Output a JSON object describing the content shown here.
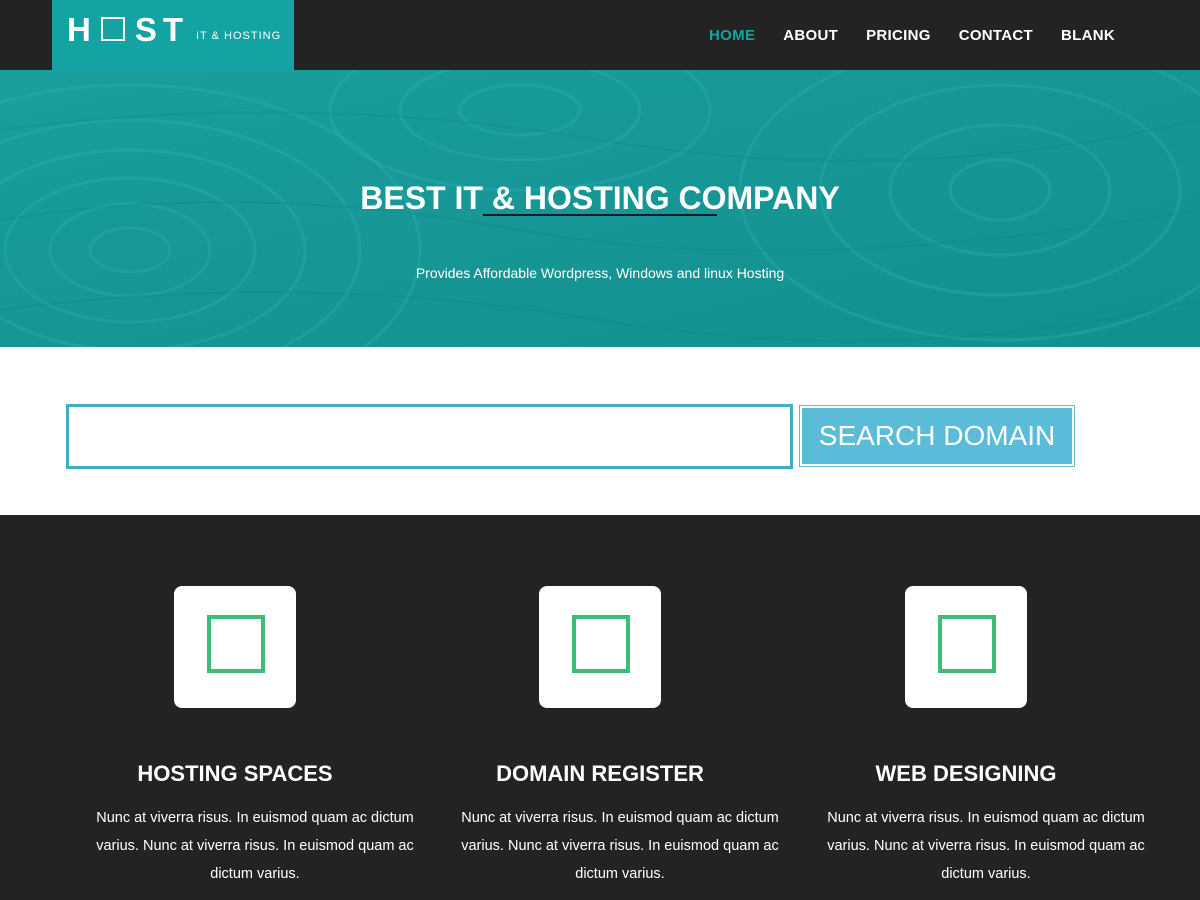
{
  "header": {
    "logo_left": "H",
    "logo_right": "ST",
    "tagline": "IT & HOSTING",
    "nav": [
      {
        "label": "HOME",
        "active": true
      },
      {
        "label": "ABOUT",
        "active": false
      },
      {
        "label": "PRICING",
        "active": false
      },
      {
        "label": "CONTACT",
        "active": false
      },
      {
        "label": "BLANK",
        "active": false
      }
    ]
  },
  "hero": {
    "title": "BEST IT & HOSTING COMPANY",
    "subtitle": "Provides Affordable Wordpress, Windows and linux Hosting"
  },
  "search": {
    "input_value": "",
    "button_label": "SEARCH DOMAIN"
  },
  "features": [
    {
      "icon": "square-icon",
      "title": "HOSTING SPACES",
      "description": "Nunc at viverra risus. In euismod quam ac dictum varius. Nunc at viverra risus. In euismod quam ac dictum varius."
    },
    {
      "icon": "square-icon",
      "title": "DOMAIN REGISTER",
      "description": "Nunc at viverra risus. In euismod quam ac dictum varius. Nunc at viverra risus. In euismod quam ac dictum varius."
    },
    {
      "icon": "square-icon",
      "title": "WEB DESIGNING",
      "description": "Nunc at viverra risus. In euismod quam ac dictum varius. Nunc at viverra risus. In euismod quam ac dictum varius."
    }
  ],
  "colors": {
    "accent": "#14a3a3",
    "dark_background": "#232323",
    "search_border": "#41aec4",
    "search_button": "#5bbcd9",
    "icon_green": "#3dbe78"
  }
}
